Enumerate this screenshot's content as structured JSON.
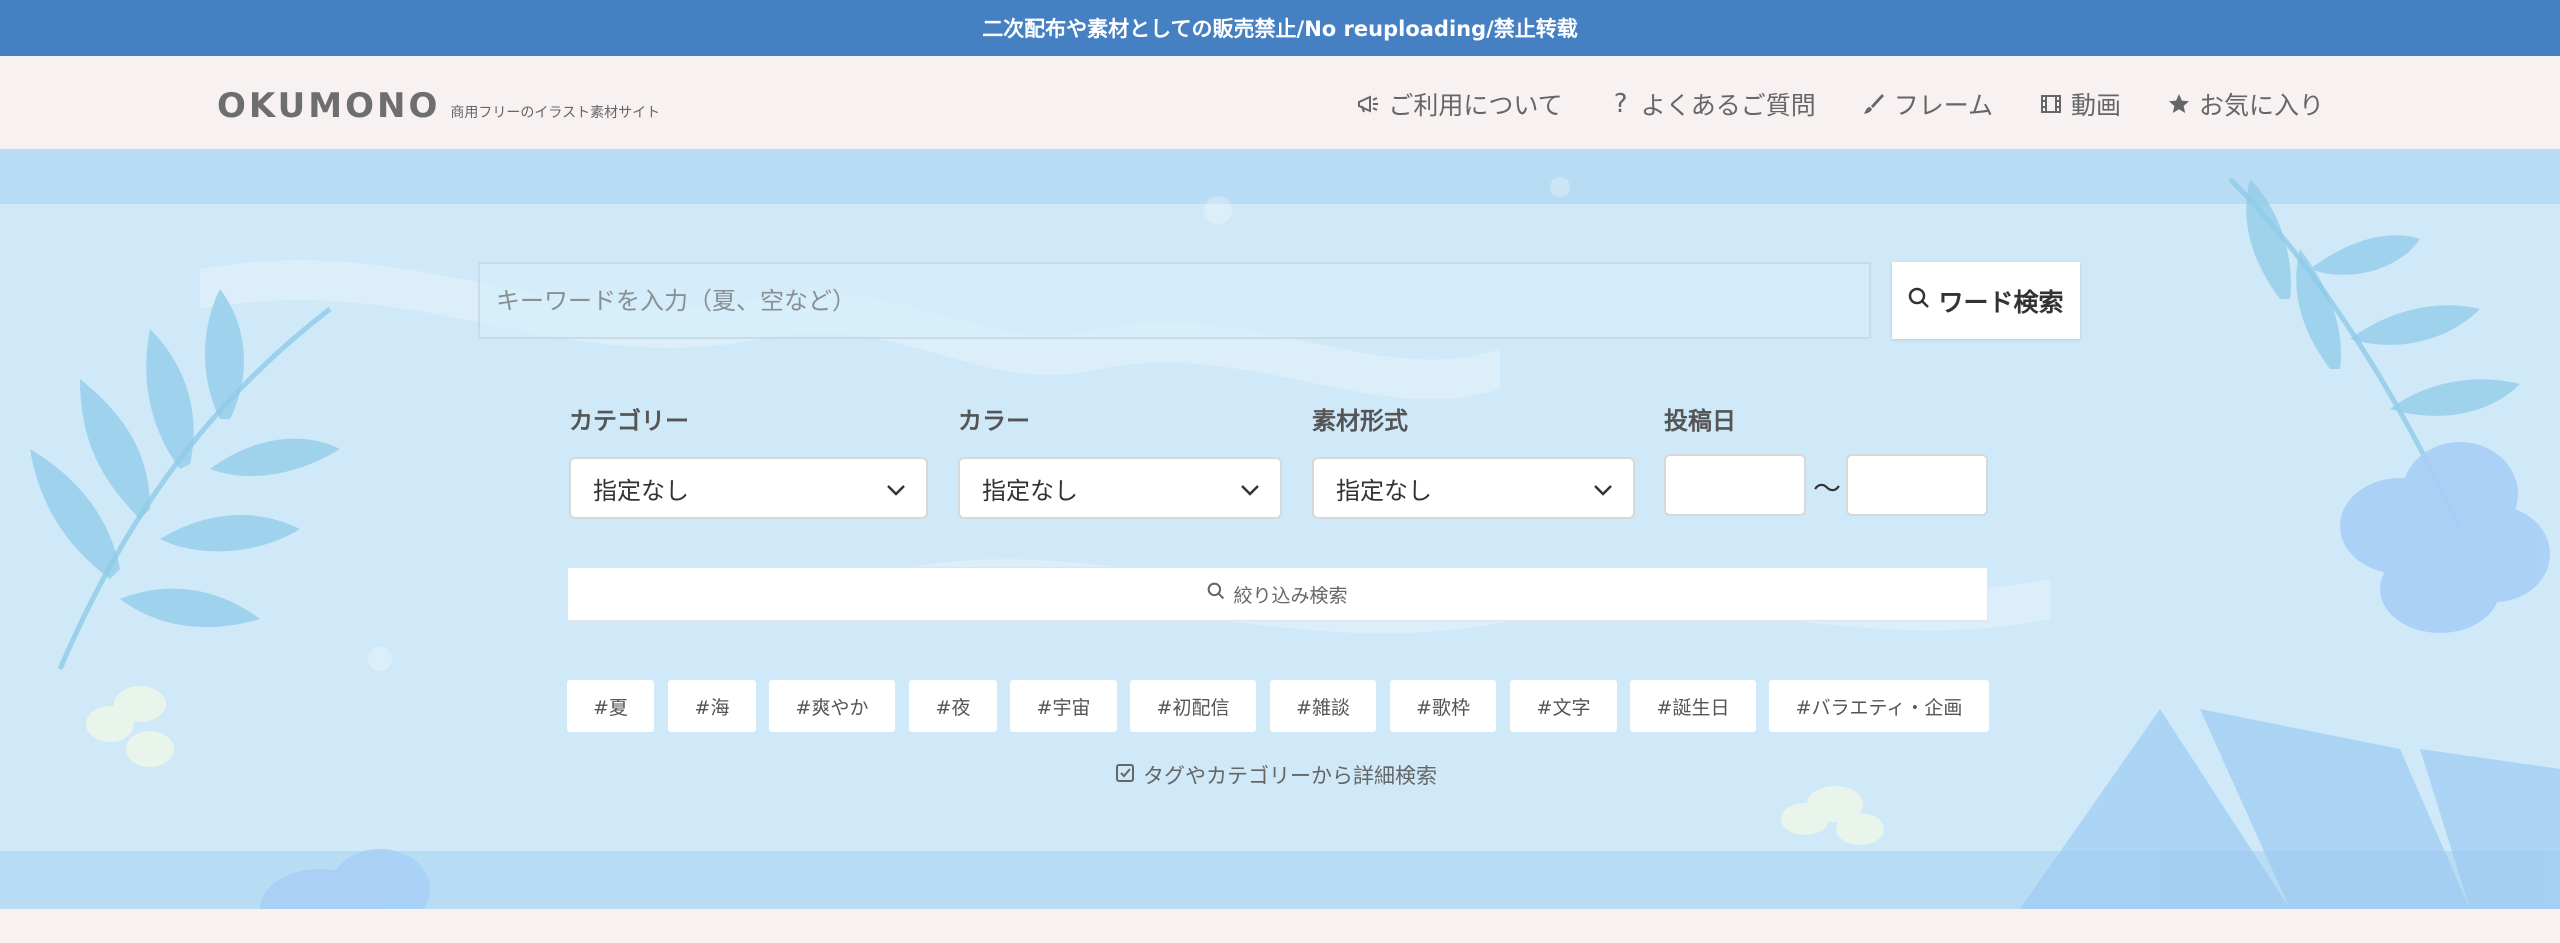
{
  "notice": "二次配布や素材としての販売禁止/No reuploading/禁止转载",
  "header": {
    "logo_text": "OKUMONO",
    "logo_tagline": "商用フリーのイラスト素材サイト",
    "nav": [
      {
        "label": "ご利用について",
        "icon": "megaphone-icon"
      },
      {
        "label": "よくあるご質問",
        "icon": "question-icon"
      },
      {
        "label": "フレーム",
        "icon": "brush-icon"
      },
      {
        "label": "動画",
        "icon": "film-icon"
      },
      {
        "label": "お気に入り",
        "icon": "star-icon"
      }
    ]
  },
  "search": {
    "placeholder": "キーワードを入力（夏、空など）",
    "button_label": "ワード検索"
  },
  "filters": {
    "category_label": "カテゴリー",
    "category_value": "指定なし",
    "color_label": "カラー",
    "color_value": "指定なし",
    "format_label": "素材形式",
    "format_value": "指定なし",
    "date_label": "投稿日",
    "date_separator": "〜"
  },
  "narrow_search_label": "絞り込み検索",
  "tags": [
    "#夏",
    "#海",
    "#爽やか",
    "#夜",
    "#宇宙",
    "#初配信",
    "#雑談",
    "#歌枠",
    "#文字",
    "#誕生日",
    "#バラエティ・企画"
  ],
  "detail_search_label": "タグやカテゴリーから詳細検索",
  "colors": {
    "notice_bg": "#4580c3",
    "header_bg": "#f7f1f1",
    "hero_bg": "#cfe9f8"
  }
}
